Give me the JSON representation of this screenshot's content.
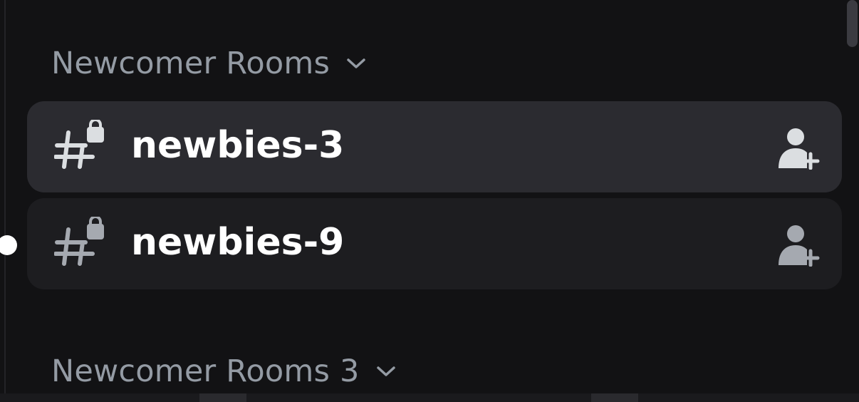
{
  "channel_list": {
    "categories": [
      {
        "label": "Newcomer Rooms",
        "chevron_icon": "chevron-down-icon",
        "channels": [
          {
            "name": "newbies-3",
            "state": "selected",
            "type_icon": "private-text-channel-icon",
            "action_icon": "add-member-icon"
          },
          {
            "name": "newbies-9",
            "state": "unread",
            "type_icon": "private-text-channel-icon",
            "action_icon": "add-member-icon"
          }
        ]
      },
      {
        "label": "Newcomer Rooms 3",
        "chevron_icon": "chevron-down-icon",
        "channels": []
      }
    ]
  },
  "colors": {
    "background": "#121214",
    "selected_row": "#2b2b30",
    "hover_row": "#1d1d20",
    "category_text": "#949ba4",
    "channel_text": "#ffffff",
    "unread_indicator": "#ffffff",
    "scrollbar": "#3b3b41"
  }
}
